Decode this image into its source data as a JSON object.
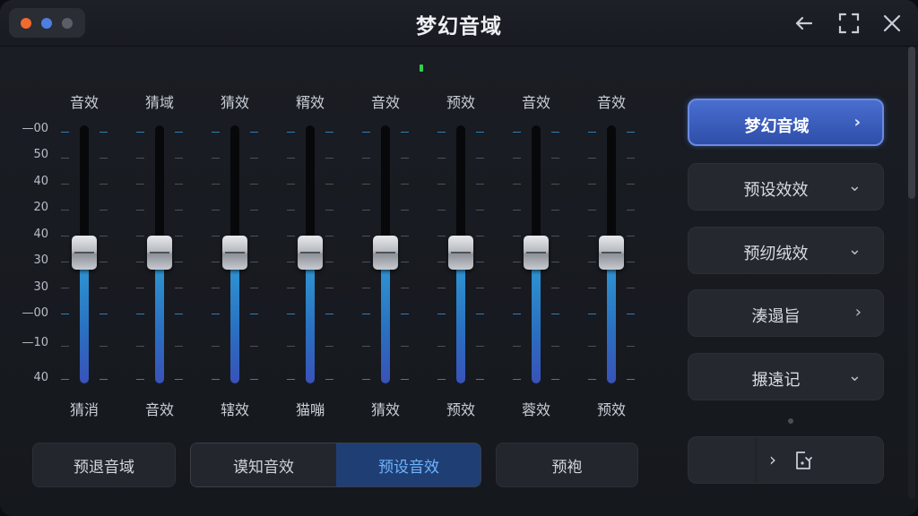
{
  "window": {
    "title": "梦幻音域"
  },
  "eq": {
    "scale": [
      "00",
      "50",
      "40",
      "20",
      "40",
      "30",
      "30",
      "00",
      "10",
      "40"
    ],
    "bands": [
      {
        "top": "音效",
        "bottom": "猜消",
        "level": 0.5
      },
      {
        "top": "猜域",
        "bottom": "音效",
        "level": 0.5
      },
      {
        "top": "猜效",
        "bottom": "辖效",
        "level": 0.5
      },
      {
        "top": "糈效",
        "bottom": "猫嘣",
        "level": 0.5
      },
      {
        "top": "音效",
        "bottom": "猜效",
        "level": 0.5
      },
      {
        "top": "预效",
        "bottom": "预效",
        "level": 0.5
      },
      {
        "top": "音效",
        "bottom": "蓉效",
        "level": 0.5
      },
      {
        "top": "音效",
        "bottom": "预效",
        "level": 0.5
      }
    ]
  },
  "bottom": {
    "left_button": "预退音域",
    "segment": [
      "谟知音效",
      "预设音效"
    ],
    "segment_selected": 1,
    "right_button": "预袍"
  },
  "presets": [
    {
      "label": "梦幻音域",
      "chevron": "›",
      "selected": true
    },
    {
      "label": "预设效效",
      "chevron": "⌄",
      "selected": false
    },
    {
      "label": "预纫绒效",
      "chevron": "⌄",
      "selected": false
    },
    {
      "label": "湊遢旨",
      "chevron": "›",
      "selected": false
    },
    {
      "label": "搌遠记",
      "chevron": "⌄",
      "selected": false
    }
  ],
  "colors": {
    "accent": "#3a5ec4",
    "fill_top": "#2f9bd6",
    "fill_bottom": "#3952b9",
    "indicator": "#2fd14a"
  },
  "icons": [
    "close-dot-icon",
    "back-arrow-icon",
    "expand-icon",
    "close-icon",
    "chevron-right-icon",
    "chevron-down-icon",
    "export-icon"
  ]
}
